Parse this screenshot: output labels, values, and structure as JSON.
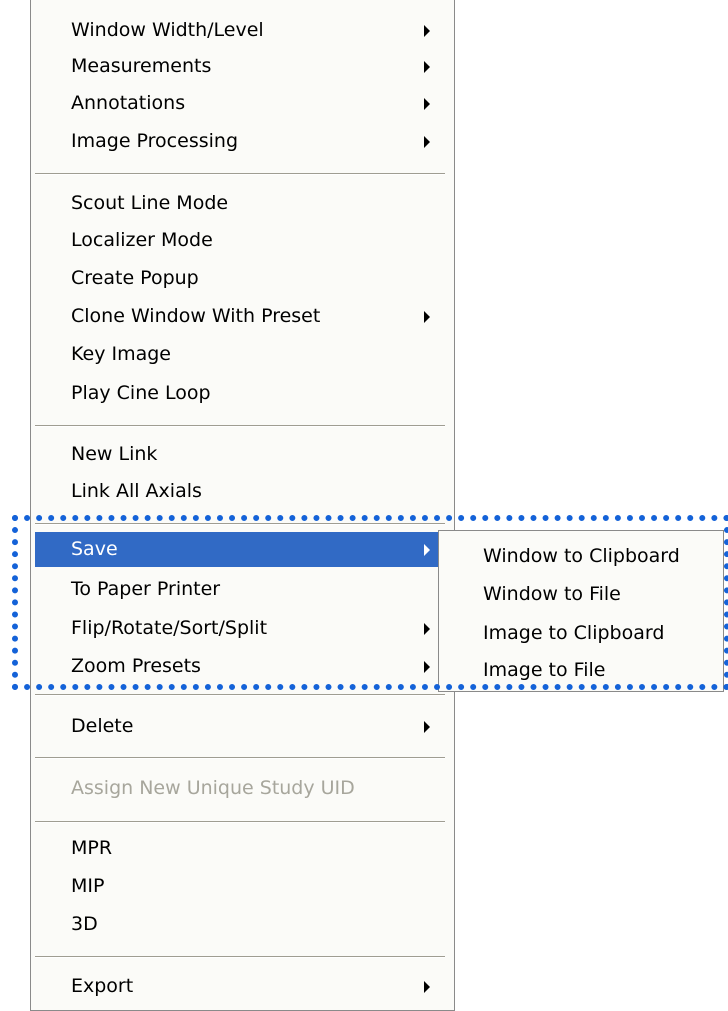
{
  "context_menu": {
    "items": [
      {
        "label": "Window Width/Level",
        "has_submenu": true
      },
      {
        "label": "Measurements",
        "has_submenu": true
      },
      {
        "label": "Annotations",
        "has_submenu": true
      },
      {
        "label": "Image Processing",
        "has_submenu": true
      },
      {
        "label": "Scout Line Mode",
        "has_submenu": false
      },
      {
        "label": "Localizer Mode",
        "has_submenu": false
      },
      {
        "label": "Create Popup",
        "has_submenu": false
      },
      {
        "label": "Clone Window With Preset",
        "has_submenu": true
      },
      {
        "label": "Key Image",
        "has_submenu": false
      },
      {
        "label": "Play Cine Loop",
        "has_submenu": false
      },
      {
        "label": "New Link",
        "has_submenu": false
      },
      {
        "label": "Link All Axials",
        "has_submenu": false
      },
      {
        "label": "Save",
        "has_submenu": true,
        "highlighted": true
      },
      {
        "label": "To Paper Printer",
        "has_submenu": false
      },
      {
        "label": "Flip/Rotate/Sort/Split",
        "has_submenu": true
      },
      {
        "label": "Zoom Presets",
        "has_submenu": true
      },
      {
        "label": "Delete",
        "has_submenu": true
      },
      {
        "label": "Assign New Unique Study UID",
        "has_submenu": false,
        "disabled": true
      },
      {
        "label": "MPR",
        "has_submenu": false
      },
      {
        "label": "MIP",
        "has_submenu": false
      },
      {
        "label": "3D",
        "has_submenu": false
      },
      {
        "label": "Export",
        "has_submenu": true
      }
    ]
  },
  "save_submenu": {
    "items": [
      {
        "label": "Window to Clipboard"
      },
      {
        "label": "Window to File"
      },
      {
        "label": "Image to Clipboard"
      },
      {
        "label": "Image to File"
      }
    ]
  },
  "colors": {
    "highlight": "#316ac5",
    "focus_outline": "#1462d8",
    "disabled_text": "#a7a69c",
    "menu_background": "#fbfbf8"
  }
}
